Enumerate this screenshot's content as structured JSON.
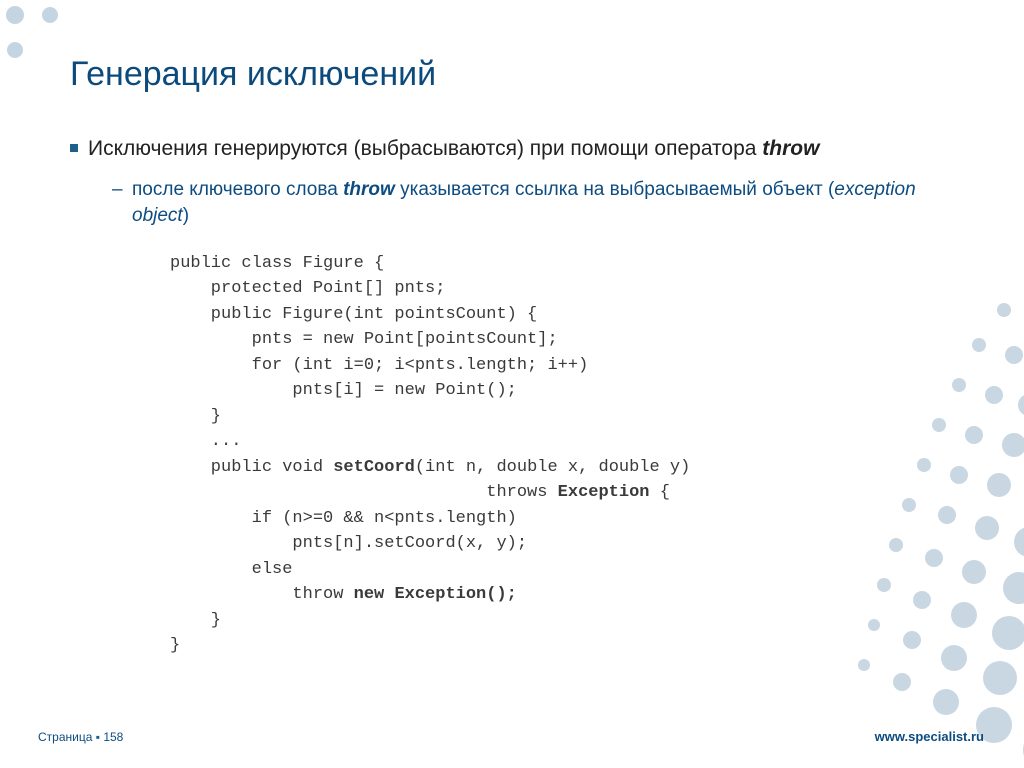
{
  "title": "Генерация исключений",
  "bullet1_a": "Исключения генерируются (выбрасываются) при помощи оператора ",
  "bullet1_b": "throw",
  "bullet2_a": "после ключевого слова ",
  "bullet2_b": "throw",
  "bullet2_c": " указывается ссылка на выбрасываемый объект (",
  "bullet2_d": "exception object",
  "bullet2_e": ")",
  "code": {
    "l1": "public class Figure {",
    "l2": "    protected Point[] pnts;",
    "l3": "    public Figure(int pointsCount) {",
    "l4": "        pnts = new Point[pointsCount];",
    "l5": "        for (int i=0; i<pnts.length; i++)",
    "l6": "            pnts[i] = new Point();",
    "l7": "    }",
    "l8": "    ...",
    "l9a": "    public void ",
    "l9b": "setCoord",
    "l9c": "(int n, double x, double y)",
    "l10a": "                               throws ",
    "l10b": "Exception",
    "l10c": " {",
    "l11": "        if (n>=0 && n<pnts.length)",
    "l12": "            pnts[n].setCoord(x, y);",
    "l13": "        else",
    "l14a": "            throw ",
    "l14b": "new Exception();",
    "l15": "    }",
    "l16": "}"
  },
  "footer": {
    "page_label": "Страница",
    "page_num": "158",
    "url": "www.specialist.ru"
  }
}
